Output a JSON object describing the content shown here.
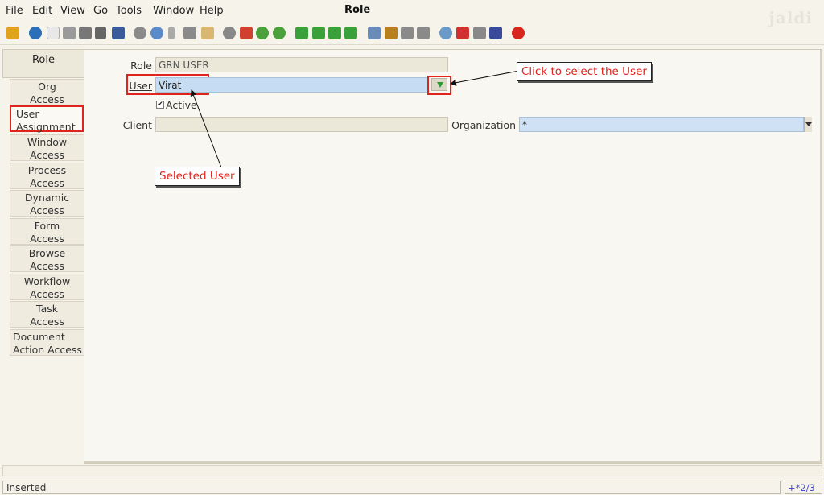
{
  "window": {
    "title": "Role",
    "brand": "jaldi"
  },
  "menu": [
    {
      "label": "File"
    },
    {
      "label": "Edit"
    },
    {
      "label": "View"
    },
    {
      "label": "Go"
    },
    {
      "label": "Tools"
    },
    {
      "label": "Window"
    },
    {
      "label": "Help"
    }
  ],
  "toolbar_icons": [
    "undo-icon",
    "help-icon",
    "new-record-icon",
    "copy-record-icon",
    "delete-icon",
    "delete-selection-icon",
    "save-icon",
    "refresh-icon",
    "find-icon",
    "attachment-icon",
    "chat-icon",
    "history-icon",
    "home-icon-grey",
    "home-icon",
    "previous-icon",
    "next-icon",
    "first-record-icon",
    "previous-record-icon",
    "next-record-icon",
    "last-record-icon",
    "report-icon",
    "archive-icon",
    "print-preview-icon",
    "print-icon",
    "zoom-across-icon",
    "request-icon",
    "product-info-icon",
    "workflow-icon",
    "exit-icon"
  ],
  "tabs": {
    "role": "Role",
    "items": [
      {
        "l1": "Org",
        "l2": "Access"
      },
      {
        "l1": "User",
        "l2": "Assignment"
      },
      {
        "l1": "Window",
        "l2": "Access"
      },
      {
        "l1": "Process",
        "l2": "Access"
      },
      {
        "l1": "Dynamic",
        "l2": "Access"
      },
      {
        "l1": "Form",
        "l2": "Access"
      },
      {
        "l1": "Browse",
        "l2": "Access"
      },
      {
        "l1": "Workflow",
        "l2": "Access"
      },
      {
        "l1": "Task",
        "l2": "Access"
      },
      {
        "l1": "Document",
        "l2": "Action Access"
      }
    ]
  },
  "form": {
    "role_label": "Role",
    "role_value": "GRN USER",
    "user_label": "User",
    "user_value": "Virat",
    "active_label": "Active",
    "active_checked": "✔",
    "client_label": "Client",
    "client_value": "",
    "org_label": "Organization",
    "org_value": "*"
  },
  "annotations": {
    "select_user": "Click to select the User",
    "selected_user": "Selected User"
  },
  "status": {
    "text": "Inserted",
    "record": "+*2/3"
  },
  "colors": {
    "highlight": "#e0231d",
    "field_blue": "#c5dcf2",
    "background": "#f6f3ea"
  }
}
